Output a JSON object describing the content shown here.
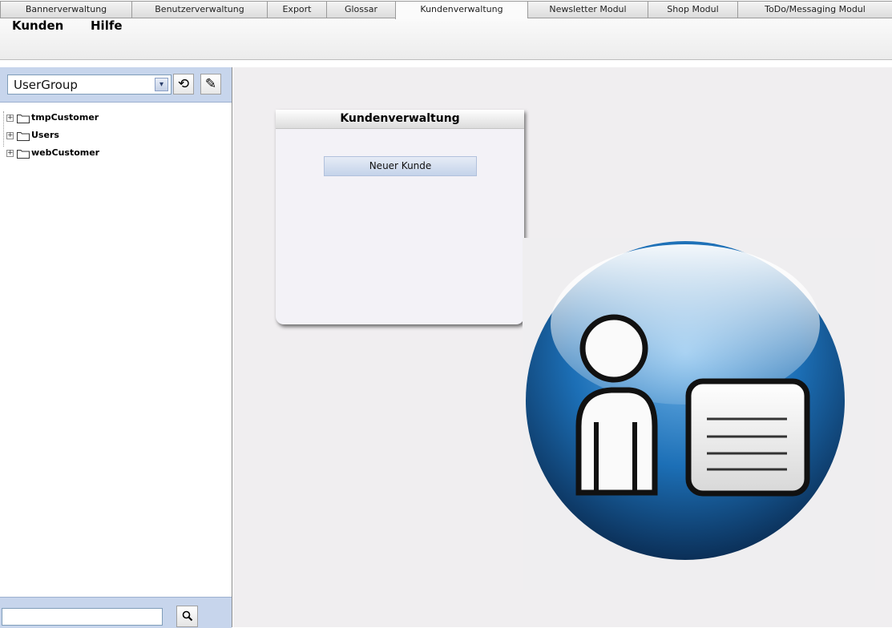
{
  "tabs": [
    {
      "label": "Bannerverwaltung",
      "active": false
    },
    {
      "label": "Benutzerverwaltung",
      "active": false
    },
    {
      "label": "Export",
      "active": false
    },
    {
      "label": "Glossar",
      "active": false
    },
    {
      "label": "Kundenverwaltung",
      "active": true
    },
    {
      "label": "Newsletter Modul",
      "active": false
    },
    {
      "label": "Shop Modul",
      "active": false
    },
    {
      "label": "ToDo/Messaging Modul",
      "active": false
    }
  ],
  "menu": {
    "items": [
      "Kunden",
      "Hilfe"
    ]
  },
  "sidebar": {
    "group_select": {
      "value": "UserGroup",
      "arrow_icon": "chevron-down-icon"
    },
    "refresh_icon": "⟲",
    "edit_icon": "✎",
    "tree": [
      {
        "label": "tmpCustomer"
      },
      {
        "label": "Users"
      },
      {
        "label": "webCustomer"
      }
    ],
    "search": {
      "value": "",
      "icon": "🔍"
    }
  },
  "main": {
    "card": {
      "title": "Kundenverwaltung",
      "button_label": "Neuer Kunde"
    }
  },
  "colors": {
    "panel_blue": "#c7d5ec",
    "orb_blue": "#1a6bb0",
    "main_bg": "#f0eef0"
  }
}
